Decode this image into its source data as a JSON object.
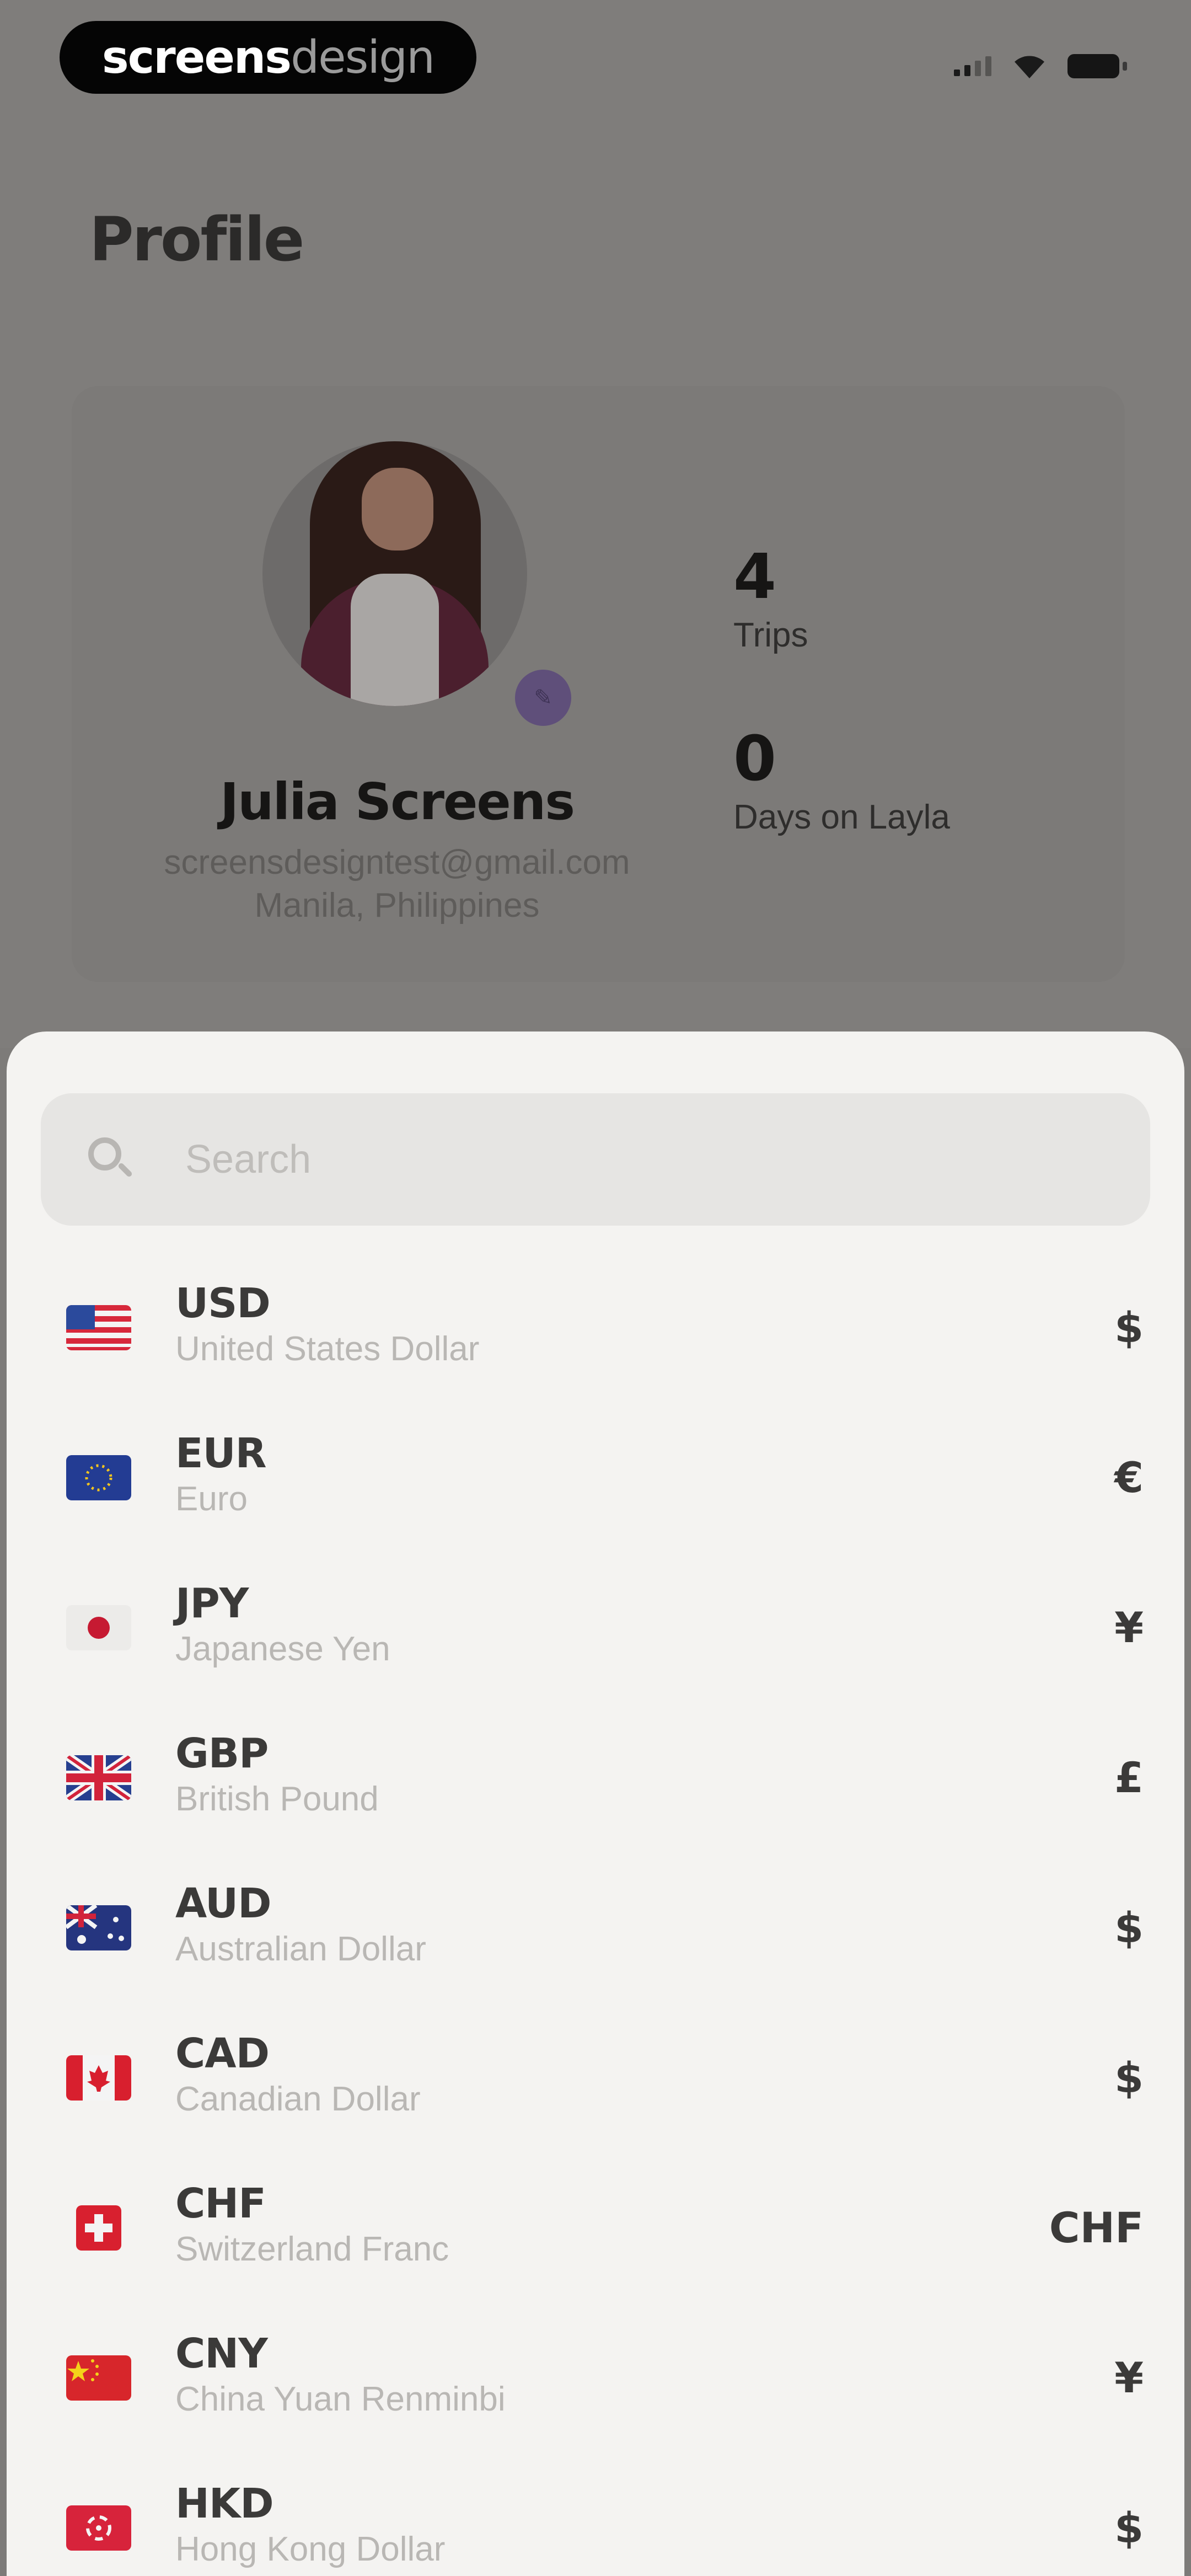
{
  "status_bar": {
    "brand_left": "screens",
    "brand_right": "design"
  },
  "profile": {
    "title": "Profile",
    "name": "Julia Screens",
    "email": "screensdesigntest@gmail.com",
    "location": "Manila, Philippines",
    "stats": [
      {
        "value": "4",
        "label": "Trips"
      },
      {
        "value": "0",
        "label": "Days on Layla"
      }
    ]
  },
  "currency_sheet": {
    "search_placeholder": "Search",
    "currencies": [
      {
        "code": "USD",
        "name": "United States Dollar",
        "symbol": "$",
        "flag": "us-flag-icon",
        "colors": [
          "#2b4a9c",
          "#d7283b",
          "#f4f4f4"
        ]
      },
      {
        "code": "EUR",
        "name": "Euro",
        "symbol": "€",
        "flag": "eu-flag-icon",
        "colors": [
          "#233c93",
          "#f4c51e"
        ]
      },
      {
        "code": "JPY",
        "name": "Japanese Yen",
        "symbol": "¥",
        "flag": "jp-flag-icon",
        "colors": [
          "#f1f0ee",
          "#c61a32"
        ]
      },
      {
        "code": "GBP",
        "name": "British Pound",
        "symbol": "£",
        "flag": "uk-flag-icon",
        "colors": [
          "#263f8f",
          "#d2233b",
          "#f4f4f4"
        ]
      },
      {
        "code": "AUD",
        "name": "Australian Dollar",
        "symbol": "$",
        "flag": "au-flag-icon",
        "colors": [
          "#25357f",
          "#d2233b",
          "#f4f4f4"
        ]
      },
      {
        "code": "CAD",
        "name": "Canadian Dollar",
        "symbol": "$",
        "flag": "ca-flag-icon",
        "colors": [
          "#d81f2e",
          "#f4f4f4"
        ]
      },
      {
        "code": "CHF",
        "name": "Switzerland Franc",
        "symbol": "CHF",
        "flag": "ch-flag-icon",
        "colors": [
          "#d8202f",
          "#f4f4f4"
        ]
      },
      {
        "code": "CNY",
        "name": "China Yuan Renminbi",
        "symbol": "¥",
        "flag": "cn-flag-icon",
        "colors": [
          "#d7262b",
          "#f4d21a"
        ]
      },
      {
        "code": "HKD",
        "name": "Hong Kong Dollar",
        "symbol": "$",
        "flag": "hk-flag-icon",
        "colors": [
          "#d7233b",
          "#f4f4f4"
        ]
      }
    ]
  }
}
